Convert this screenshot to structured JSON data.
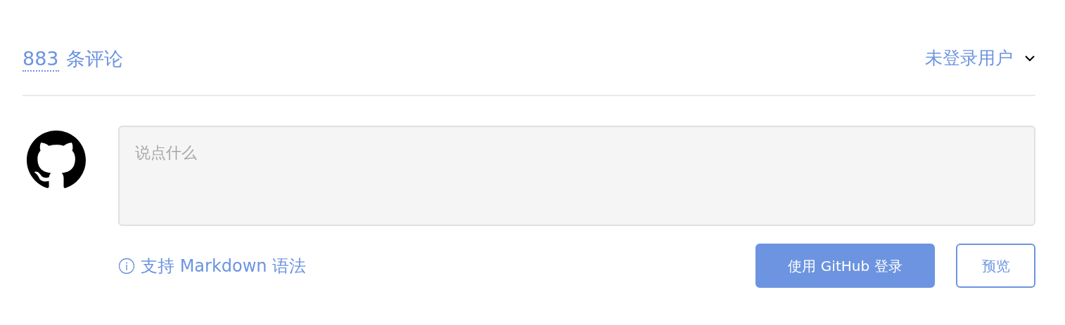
{
  "header": {
    "count": "883",
    "label": "条评论"
  },
  "user_menu": {
    "label": "未登录用户"
  },
  "editor": {
    "placeholder": "说点什么"
  },
  "hint": {
    "text": "支持 Markdown 语法"
  },
  "buttons": [
    {
      "label": "使用 GitHub 登录",
      "kind": "primary"
    },
    {
      "label": "预览",
      "kind": "outline"
    }
  ]
}
